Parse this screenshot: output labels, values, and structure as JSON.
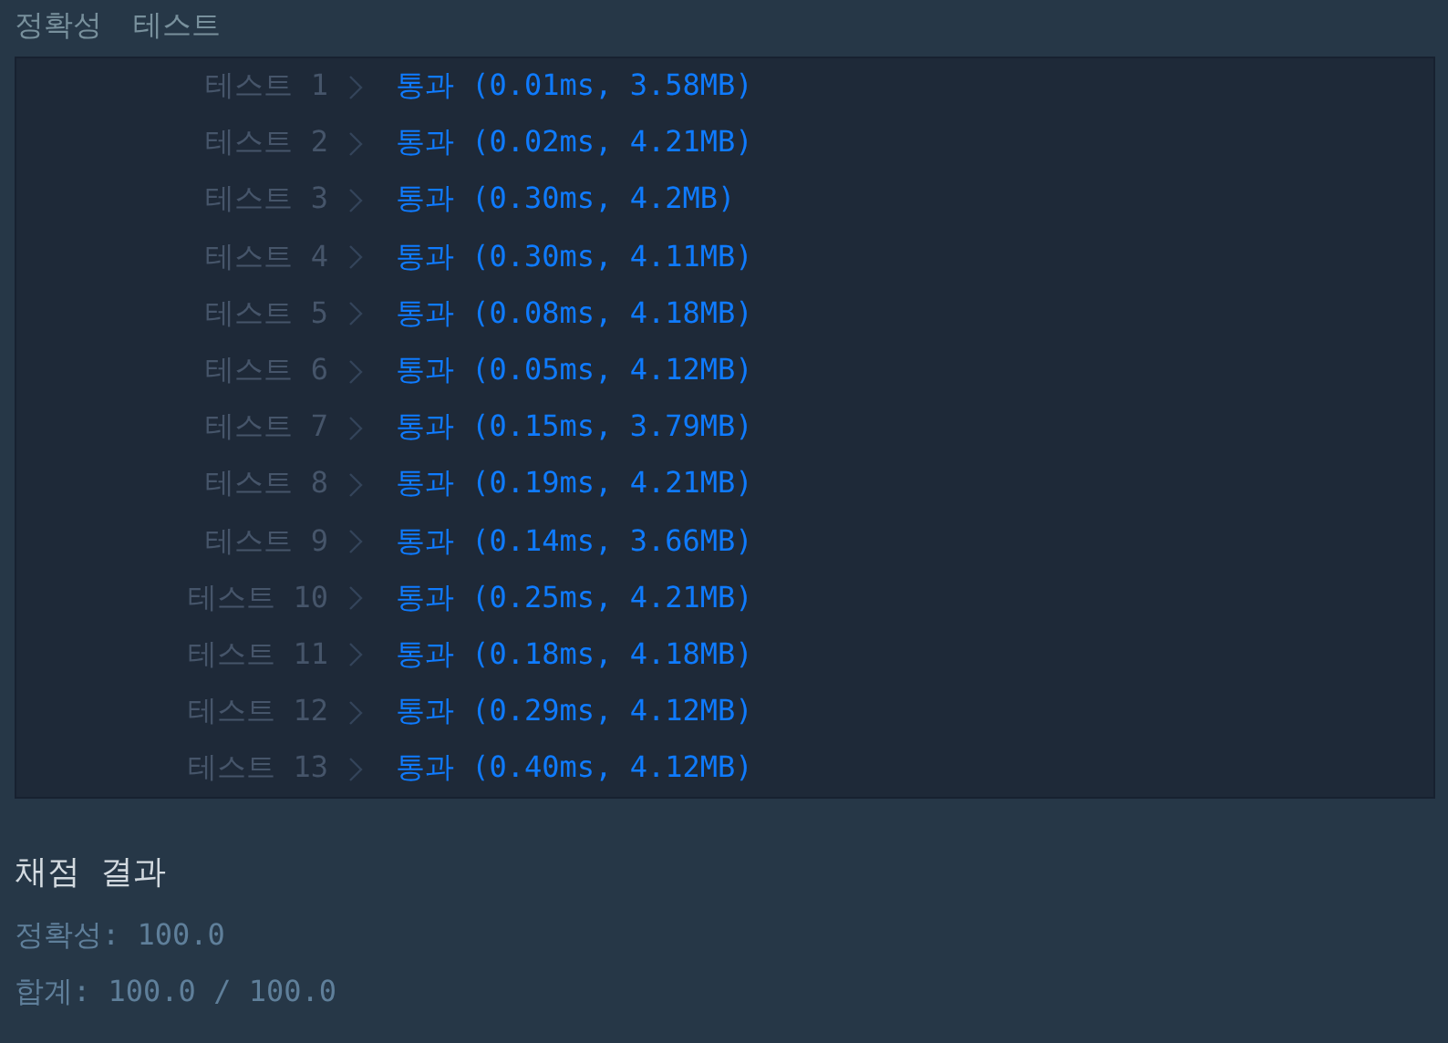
{
  "header": {
    "items": [
      "정확성",
      "테스트"
    ]
  },
  "tests": [
    {
      "label": "테스트 1",
      "result": "통과 (0.01ms, 3.58MB)"
    },
    {
      "label": "테스트 2",
      "result": "통과 (0.02ms, 4.21MB)"
    },
    {
      "label": "테스트 3",
      "result": "통과 (0.30ms, 4.2MB)"
    },
    {
      "label": "테스트 4",
      "result": "통과 (0.30ms, 4.11MB)"
    },
    {
      "label": "테스트 5",
      "result": "통과 (0.08ms, 4.18MB)"
    },
    {
      "label": "테스트 6",
      "result": "통과 (0.05ms, 4.12MB)"
    },
    {
      "label": "테스트 7",
      "result": "통과 (0.15ms, 3.79MB)"
    },
    {
      "label": "테스트 8",
      "result": "통과 (0.19ms, 4.21MB)"
    },
    {
      "label": "테스트 9",
      "result": "통과 (0.14ms, 3.66MB)"
    },
    {
      "label": "테스트 10",
      "result": "통과 (0.25ms, 4.21MB)"
    },
    {
      "label": "테스트 11",
      "result": "통과 (0.18ms, 4.18MB)"
    },
    {
      "label": "테스트 12",
      "result": "통과 (0.29ms, 4.12MB)"
    },
    {
      "label": "테스트 13",
      "result": "통과 (0.40ms, 4.12MB)"
    }
  ],
  "summary": {
    "title": "채점 결과",
    "lines": [
      "정확성: 100.0",
      "합계: 100.0 / 100.0"
    ]
  }
}
